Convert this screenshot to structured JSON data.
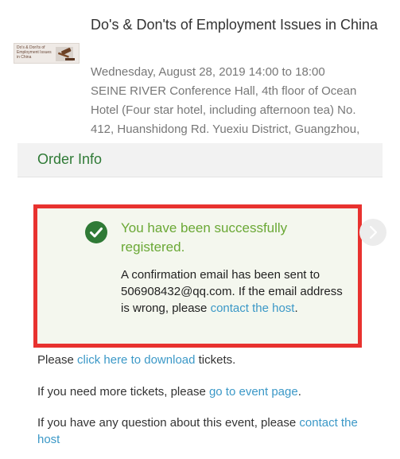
{
  "event": {
    "thumbnail_text": "Do's & Don'ts of Employment Issues in China",
    "title": "Do's & Don'ts of Employment Issues in China",
    "datetime": "Wednesday, August 28, 2019 14:00 to 18:00",
    "location_lines": [
      "SEINE RIVER Conference Hall, 4th floor of Ocean",
      "Hotel (Four star hotel, including afternoon tea) No.",
      "412, Huanshidong Rd. Yuexiu District, Guangzhou,"
    ]
  },
  "order": {
    "section_title": "Order Info",
    "success_title": "You have been successfully registered.",
    "confirmation_prefix": "A confirmation email has been sent to 506908432@qq.com. If the email address is wrong, please",
    "contact_link": "contact the host",
    "confirmation_suffix": "."
  },
  "tickets": {
    "download_prefix": "Please",
    "download_link": "click here to download",
    "download_suffix": "tickets.",
    "more_prefix": "If you need more tickets, please",
    "more_link": "go to event page",
    "more_suffix": ".",
    "question_prefix": "If you have any question about this event,  please",
    "question_link": "contact the host"
  },
  "colors": {
    "accent_green": "#2f7a36",
    "success_green": "#6aa835",
    "link_blue": "#3b98c7",
    "highlight_red": "#e8322f"
  },
  "icons": {
    "check": "check-circle-icon",
    "next": "chevron-right-icon",
    "gavel": "gavel-icon"
  }
}
